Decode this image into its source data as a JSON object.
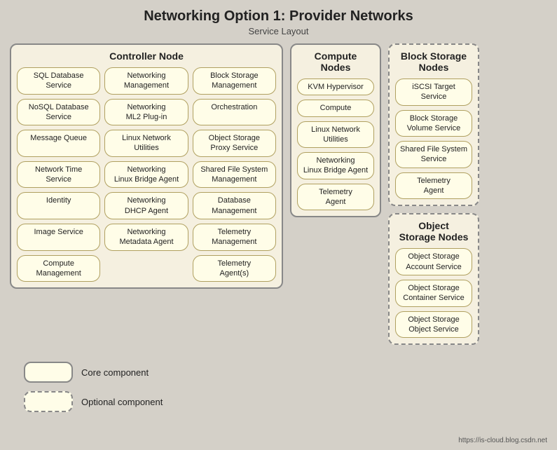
{
  "title": "Networking Option 1: Provider Networks",
  "subtitle": "Service Layout",
  "watermark": "https://is-cloud.blog.csdn.net",
  "legend": {
    "core_label": "Core component",
    "optional_label": "Optional component"
  },
  "controller": {
    "title": "Controller Node",
    "items": [
      "SQL Database\nService",
      "Networking\nManagement",
      "Block Storage\nManagement",
      "NoSQL Database\nService",
      "Networking\nML2 Plug-in",
      "Orchestration",
      "Message Queue",
      "Linux Network\nUtilities",
      "Object Storage\nProxy Service",
      "Network Time\nService",
      "Networking\nLinux Bridge Agent",
      "Shared File System\nManagement",
      "Identity",
      "Networking\nDHCP Agent",
      "Database\nManagement",
      "Image Service",
      "Networking\nMetadata Agent",
      "Telemetry\nManagement",
      "Compute\nManagement",
      "",
      "Telemetry\nAgent(s)"
    ]
  },
  "compute": {
    "title": "Compute\nNodes",
    "items": [
      "KVM Hypervisor",
      "Compute",
      "Linux Network\nUtilities",
      "Networking\nLinux Bridge Agent",
      "Telemetry\nAgent"
    ]
  },
  "block_storage": {
    "title": "Block Storage\nNodes",
    "items": [
      "iSCSI Target\nService",
      "Block Storage\nVolume Service",
      "Shared File System\nService",
      "Telemetry\nAgent"
    ]
  },
  "object_storage": {
    "title": "Object\nStorage Nodes",
    "items": [
      "Object Storage\nAccount Service",
      "Object Storage\nContainer Service",
      "Object Storage\nObject Service"
    ]
  }
}
